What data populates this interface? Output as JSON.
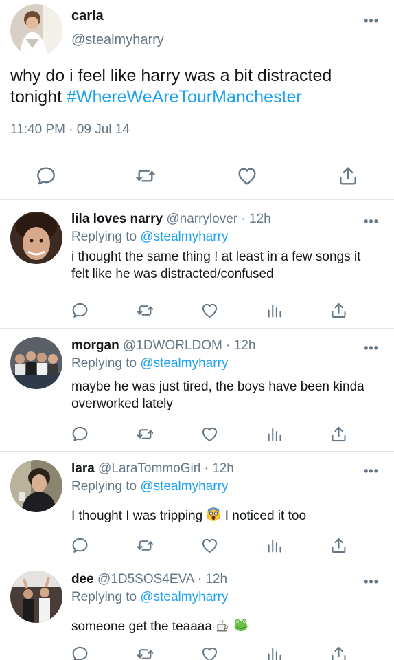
{
  "main_tweet": {
    "display_name": "carla",
    "handle": "@stealmyharry",
    "text_prefix": "why do i feel like harry was a bit distracted tonight ",
    "hashtag": "#WhereWeAreTourManchester",
    "timestamp": "11:40 PM · 09 Jul 14",
    "more_glyph": "•••",
    "actions": [
      "reply-icon",
      "retweet-icon",
      "like-icon",
      "share-icon"
    ]
  },
  "replies": [
    {
      "display_name": "lila loves narry",
      "handle": "@narrylover",
      "separator": "·",
      "time": "12h",
      "replying_label": "Replying to",
      "replying_to": "@stealmyharry",
      "text": "i thought the same thing ! at least in a few songs it felt like he was distracted/confused"
    },
    {
      "display_name": "morgan",
      "handle": "@1DWORLDOM",
      "separator": "·",
      "time": "12h",
      "replying_label": "Replying to",
      "replying_to": "@stealmyharry",
      "text": "maybe he was just tired, the boys have been kinda overworked lately"
    },
    {
      "display_name": "lara",
      "handle": "@LaraTommoGirl",
      "separator": "·",
      "time": "12h",
      "replying_label": "Replying to",
      "replying_to": "@stealmyharry",
      "text": "I thought I was tripping",
      "text_after": " I noticed it too",
      "emoji": "screaming-face-emoji"
    },
    {
      "display_name": "dee",
      "handle": "@1D5SOS4EVA",
      "separator": "·",
      "time": "12h",
      "replying_label": "Replying to",
      "replying_to": "@stealmyharry",
      "text": "someone get the teaaaa",
      "emoji": [
        "hot-beverage-emoji",
        "frog-emoji"
      ]
    }
  ],
  "colors": {
    "link": "#1da1f2",
    "secondary": "#657786",
    "divider": "#e1e8ed",
    "text": "#14171a"
  }
}
